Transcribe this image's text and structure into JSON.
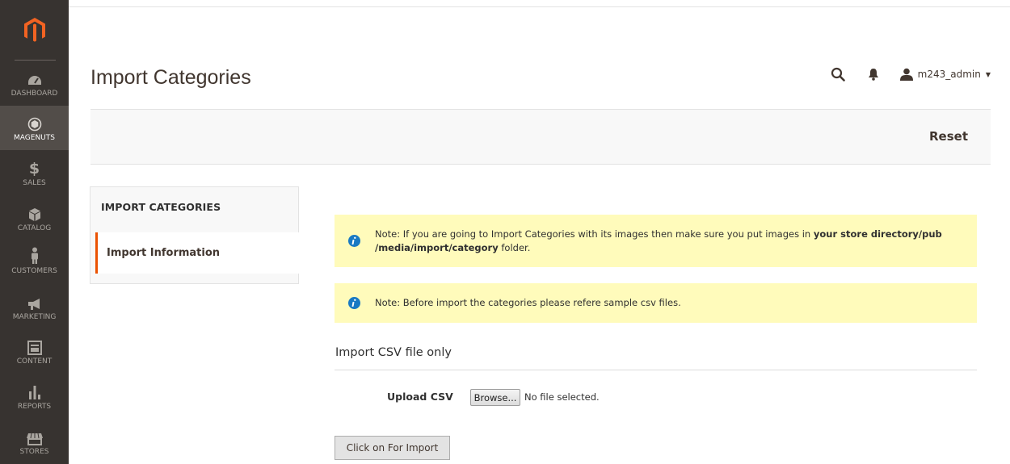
{
  "sidebar": {
    "items": [
      {
        "label": "DASHBOARD",
        "icon": "dashboard-icon"
      },
      {
        "label": "MAGENUTS",
        "icon": "magenuts-icon"
      },
      {
        "label": "SALES",
        "icon": "dollar-icon"
      },
      {
        "label": "CATALOG",
        "icon": "catalog-cube-icon"
      },
      {
        "label": "CUSTOMERS",
        "icon": "customer-person-icon"
      },
      {
        "label": "MARKETING",
        "icon": "megaphone-icon"
      },
      {
        "label": "CONTENT",
        "icon": "content-layout-icon"
      },
      {
        "label": "REPORTS",
        "icon": "bar-chart-icon"
      },
      {
        "label": "STORES",
        "icon": "store-awning-icon"
      }
    ],
    "active": "MAGENUTS"
  },
  "header": {
    "title": "Import Categories",
    "username": "m243_admin"
  },
  "actions": {
    "reset_label": "Reset"
  },
  "tabs": {
    "title": "IMPORT CATEGORIES",
    "items": [
      {
        "label": "Import Information"
      }
    ]
  },
  "notes": {
    "note1": {
      "before": "Note: If you are going to Import Categories with its images then make sure you put images in ",
      "bold": "your store directory/pub /media/import/category",
      "after": " folder."
    },
    "note2": {
      "text": "Note: Before import the categories please refere sample csv files."
    }
  },
  "form": {
    "section_title": "Import CSV file only",
    "upload_label": "Upload CSV",
    "browse_label": "Browse...",
    "file_status": "No file selected.",
    "import_button": "Click on For Import"
  },
  "colors": {
    "sidebar": "#373330",
    "accent": "#eb5202",
    "note_bg": "#fffbbb",
    "info_icon": "#1979c3"
  }
}
